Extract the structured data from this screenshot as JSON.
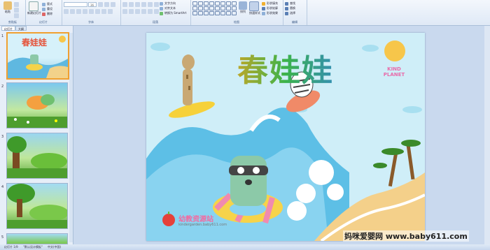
{
  "ribbon": {
    "groups": [
      {
        "label": "剪贴板",
        "buttons": [
          "粘贴"
        ]
      },
      {
        "label": "幻灯片",
        "buttons": [
          "新建幻灯片",
          "版式",
          "重设",
          "删除"
        ]
      },
      {
        "label": "字体",
        "font_size": "36"
      },
      {
        "label": "段落",
        "smartart": "转换为 SmartArt"
      },
      {
        "label": "绘图",
        "buttons": [
          "排列",
          "快速样式"
        ]
      },
      {
        "label": "编辑",
        "buttons": [
          "查找",
          "替换",
          "选择"
        ]
      }
    ],
    "para_items": [
      "文字方向",
      "对齐文本"
    ],
    "draw_items": [
      "形状填充",
      "形状轮廓",
      "形状效果"
    ]
  },
  "leftpane": {
    "tabs": [
      "幻灯片",
      "大纲"
    ],
    "slides": [
      "1",
      "2",
      "3",
      "4",
      "5"
    ]
  },
  "slide": {
    "title": "春娃娃",
    "kind_planet": "KIND PLANET",
    "brand": "幼教资源站",
    "brand_url": "kindergarden.baby611.com"
  },
  "status": {
    "slide_info": "幻灯片 1/9",
    "theme": "\"默认设计模板\"",
    "lang": "中文(中国)"
  },
  "watermark": "妈咪爱婴网 www.baby611.com"
}
